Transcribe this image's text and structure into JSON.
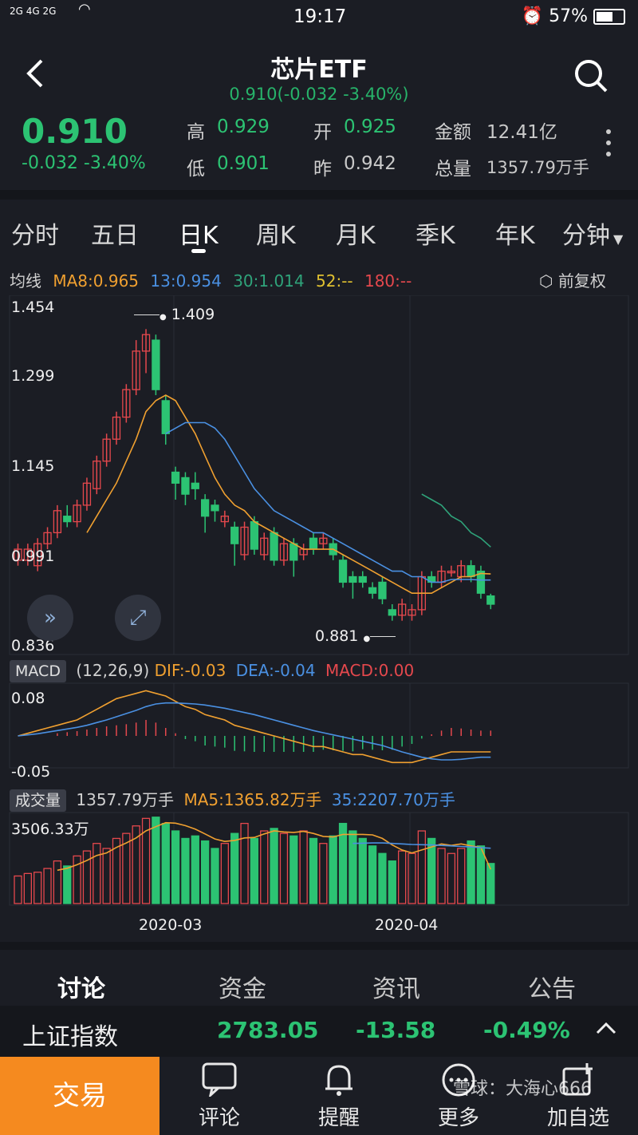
{
  "status": {
    "signal": "2G 4G 2G",
    "time": "19:17",
    "battery": "57%"
  },
  "header": {
    "title": "芯片ETF",
    "subtitle": "0.910(-0.032 -3.40%)"
  },
  "quote": {
    "price": "0.910",
    "change": "-0.032 -3.40%",
    "high_label": "高",
    "high": "0.929",
    "low_label": "低",
    "low": "0.901",
    "open_label": "开",
    "open": "0.925",
    "prev_label": "昨",
    "prev": "0.942",
    "amount_label": "金额",
    "amount": "12.41亿",
    "volume_label": "总量",
    "volume": "1357.79万手"
  },
  "tabs": [
    "分时",
    "五日",
    "日K",
    "周K",
    "月K",
    "季K",
    "年K",
    "分钟"
  ],
  "ma": {
    "label": "均线",
    "ma8": "MA8:0.965",
    "ma13": "13:0.954",
    "ma30": "30:1.014",
    "ma52": "52:--",
    "ma180": "180:--",
    "adjust": "前复权"
  },
  "price_axis": [
    "1.454",
    "1.299",
    "1.145",
    "0.991",
    "0.836"
  ],
  "annotations": {
    "high": "1.409",
    "low": "0.881"
  },
  "macd": {
    "tag": "MACD",
    "params": "(12,26,9)",
    "dif": "DIF:-0.03",
    "dea": "DEA:-0.04",
    "macd": "MACD:0.00",
    "axis_top": "0.08",
    "axis_bottom": "-0.05"
  },
  "vol": {
    "tag": "成交量",
    "total": "1357.79万手",
    "ma5": "MA5:1365.82万手",
    "ma35": "35:2207.70万手",
    "axis_top": "3506.33万"
  },
  "dates": [
    "2020-03",
    "2020-04"
  ],
  "bottom_tabs": [
    "讨论",
    "资金",
    "资讯",
    "公告"
  ],
  "index": {
    "name": "上证指数",
    "value": "2783.05",
    "change": "-13.58",
    "pct": "-0.49%"
  },
  "footer": {
    "trade": "交易",
    "comment": "评论",
    "alert": "提醒",
    "more": "更多",
    "watch": "加自选",
    "watermark": "雪球：大海心666"
  },
  "colors": {
    "up": "#e5484d",
    "down": "#2cc373",
    "ma8": "#f0a030",
    "ma13": "#4a90e2",
    "ma30": "#2fa37a",
    "accent": "#f58a1f"
  },
  "chart_data": {
    "type": "candlestick",
    "candles": [
      {
        "o": 0.99,
        "c": 1.01,
        "h": 1.02,
        "l": 0.98
      },
      {
        "o": 0.99,
        "c": 1.01,
        "h": 1.02,
        "l": 0.98
      },
      {
        "o": 0.98,
        "c": 1.02,
        "h": 1.03,
        "l": 0.97
      },
      {
        "o": 1.02,
        "c": 1.04,
        "h": 1.05,
        "l": 1.01
      },
      {
        "o": 1.04,
        "c": 1.08,
        "h": 1.09,
        "l": 1.03
      },
      {
        "o": 1.07,
        "c": 1.06,
        "h": 1.09,
        "l": 1.05
      },
      {
        "o": 1.06,
        "c": 1.09,
        "h": 1.1,
        "l": 1.05
      },
      {
        "o": 1.09,
        "c": 1.13,
        "h": 1.14,
        "l": 1.08
      },
      {
        "o": 1.12,
        "c": 1.17,
        "h": 1.18,
        "l": 1.11
      },
      {
        "o": 1.17,
        "c": 1.21,
        "h": 1.22,
        "l": 1.16
      },
      {
        "o": 1.21,
        "c": 1.25,
        "h": 1.26,
        "l": 1.2
      },
      {
        "o": 1.25,
        "c": 1.3,
        "h": 1.31,
        "l": 1.24
      },
      {
        "o": 1.3,
        "c": 1.37,
        "h": 1.39,
        "l": 1.29
      },
      {
        "o": 1.37,
        "c": 1.4,
        "h": 1.41,
        "l": 1.33
      },
      {
        "o": 1.39,
        "c": 1.3,
        "h": 1.4,
        "l": 1.29
      },
      {
        "o": 1.28,
        "c": 1.22,
        "h": 1.29,
        "l": 1.2
      },
      {
        "o": 1.15,
        "c": 1.13,
        "h": 1.16,
        "l": 1.1
      },
      {
        "o": 1.14,
        "c": 1.11,
        "h": 1.15,
        "l": 1.09
      },
      {
        "o": 1.13,
        "c": 1.12,
        "h": 1.15,
        "l": 1.1
      },
      {
        "o": 1.1,
        "c": 1.07,
        "h": 1.11,
        "l": 1.04
      },
      {
        "o": 1.09,
        "c": 1.08,
        "h": 1.1,
        "l": 1.06
      },
      {
        "o": 1.06,
        "c": 1.07,
        "h": 1.08,
        "l": 1.05
      },
      {
        "o": 1.05,
        "c": 1.02,
        "h": 1.06,
        "l": 0.98
      },
      {
        "o": 1.0,
        "c": 1.05,
        "h": 1.06,
        "l": 0.99
      },
      {
        "o": 1.06,
        "c": 1.01,
        "h": 1.07,
        "l": 1.0
      },
      {
        "o": 1.0,
        "c": 1.03,
        "h": 1.04,
        "l": 0.99
      },
      {
        "o": 1.04,
        "c": 0.99,
        "h": 1.05,
        "l": 0.98
      },
      {
        "o": 0.99,
        "c": 1.02,
        "h": 1.03,
        "l": 0.98
      },
      {
        "o": 1.02,
        "c": 0.99,
        "h": 1.03,
        "l": 0.96
      },
      {
        "o": 1.0,
        "c": 1.01,
        "h": 1.02,
        "l": 0.99
      },
      {
        "o": 1.03,
        "c": 1.01,
        "h": 1.04,
        "l": 1.0
      },
      {
        "o": 1.02,
        "c": 1.03,
        "h": 1.04,
        "l": 1.01
      },
      {
        "o": 1.02,
        "c": 1.0,
        "h": 1.03,
        "l": 0.99
      },
      {
        "o": 0.99,
        "c": 0.95,
        "h": 1.0,
        "l": 0.94
      },
      {
        "o": 0.96,
        "c": 0.95,
        "h": 0.97,
        "l": 0.92
      },
      {
        "o": 0.96,
        "c": 0.95,
        "h": 0.97,
        "l": 0.94
      },
      {
        "o": 0.94,
        "c": 0.93,
        "h": 0.95,
        "l": 0.92
      },
      {
        "o": 0.95,
        "c": 0.92,
        "h": 0.96,
        "l": 0.91
      },
      {
        "o": 0.9,
        "c": 0.89,
        "h": 0.91,
        "l": 0.88
      },
      {
        "o": 0.89,
        "c": 0.91,
        "h": 0.92,
        "l": 0.88
      },
      {
        "o": 0.89,
        "c": 0.9,
        "h": 0.91,
        "l": 0.88
      },
      {
        "o": 0.9,
        "c": 0.96,
        "h": 0.97,
        "l": 0.89
      },
      {
        "o": 0.96,
        "c": 0.95,
        "h": 0.97,
        "l": 0.94
      },
      {
        "o": 0.95,
        "c": 0.97,
        "h": 0.98,
        "l": 0.94
      },
      {
        "o": 0.97,
        "c": 0.97,
        "h": 0.98,
        "l": 0.96
      },
      {
        "o": 0.96,
        "c": 0.98,
        "h": 0.99,
        "l": 0.95
      },
      {
        "o": 0.98,
        "c": 0.96,
        "h": 0.99,
        "l": 0.95
      },
      {
        "o": 0.97,
        "c": 0.93,
        "h": 0.98,
        "l": 0.92
      },
      {
        "o": 0.925,
        "c": 0.91,
        "h": 0.929,
        "l": 0.901
      }
    ],
    "ma8": [
      null,
      null,
      null,
      null,
      null,
      null,
      null,
      1.04,
      1.07,
      1.1,
      1.13,
      1.17,
      1.21,
      1.26,
      1.28,
      1.29,
      1.28,
      1.25,
      1.22,
      1.18,
      1.14,
      1.11,
      1.09,
      1.08,
      1.06,
      1.05,
      1.04,
      1.03,
      1.02,
      1.01,
      1.01,
      1.01,
      1.01,
      1.0,
      0.99,
      0.98,
      0.97,
      0.96,
      0.95,
      0.94,
      0.93,
      0.93,
      0.93,
      0.94,
      0.95,
      0.96,
      0.96,
      0.966,
      0.965
    ],
    "ma13": [
      null,
      null,
      null,
      null,
      null,
      null,
      null,
      null,
      null,
      null,
      null,
      null,
      null,
      null,
      null,
      1.22,
      1.23,
      1.24,
      1.24,
      1.24,
      1.23,
      1.21,
      1.18,
      1.15,
      1.12,
      1.1,
      1.08,
      1.07,
      1.06,
      1.05,
      1.04,
      1.04,
      1.03,
      1.02,
      1.01,
      1.0,
      0.99,
      0.98,
      0.97,
      0.97,
      0.96,
      0.96,
      0.95,
      0.95,
      0.955,
      0.955,
      0.955,
      0.954,
      0.954
    ],
    "ma30": [
      null,
      null,
      null,
      null,
      null,
      null,
      null,
      null,
      null,
      null,
      null,
      null,
      null,
      null,
      null,
      null,
      null,
      null,
      null,
      null,
      null,
      null,
      null,
      null,
      null,
      null,
      null,
      null,
      null,
      null,
      null,
      null,
      null,
      null,
      null,
      null,
      null,
      null,
      null,
      null,
      null,
      1.11,
      1.1,
      1.09,
      1.07,
      1.06,
      1.04,
      1.03,
      1.014
    ],
    "macd_dif": [
      0.0,
      0.005,
      0.01,
      0.015,
      0.02,
      0.025,
      0.03,
      0.04,
      0.05,
      0.06,
      0.07,
      0.075,
      0.08,
      0.085,
      0.08,
      0.075,
      0.065,
      0.055,
      0.05,
      0.04,
      0.035,
      0.03,
      0.02,
      0.015,
      0.01,
      0.005,
      0.0,
      -0.005,
      -0.01,
      -0.015,
      -0.02,
      -0.02,
      -0.025,
      -0.03,
      -0.035,
      -0.035,
      -0.04,
      -0.045,
      -0.05,
      -0.05,
      -0.05,
      -0.045,
      -0.04,
      -0.035,
      -0.03,
      -0.03,
      -0.03,
      -0.03,
      -0.03
    ],
    "macd_dea": [
      0.0,
      0.002,
      0.004,
      0.007,
      0.01,
      0.013,
      0.016,
      0.02,
      0.025,
      0.03,
      0.036,
      0.042,
      0.048,
      0.055,
      0.06,
      0.062,
      0.062,
      0.061,
      0.06,
      0.058,
      0.055,
      0.052,
      0.048,
      0.044,
      0.04,
      0.035,
      0.03,
      0.025,
      0.02,
      0.015,
      0.01,
      0.006,
      0.002,
      -0.002,
      -0.006,
      -0.01,
      -0.014,
      -0.018,
      -0.024,
      -0.03,
      -0.035,
      -0.04,
      -0.043,
      -0.045,
      -0.045,
      -0.044,
      -0.042,
      -0.04,
      -0.04
    ],
    "macd_hist": [
      0,
      0,
      0,
      0,
      0.005,
      0.007,
      0.009,
      0.012,
      0.015,
      0.018,
      0.02,
      0.022,
      0.025,
      0.03,
      0.025,
      0.015,
      0.005,
      -0.006,
      -0.01,
      -0.018,
      -0.02,
      -0.022,
      -0.028,
      -0.029,
      -0.03,
      -0.03,
      -0.03,
      -0.03,
      -0.03,
      -0.03,
      -0.03,
      -0.026,
      -0.027,
      -0.028,
      -0.029,
      -0.025,
      -0.026,
      -0.027,
      -0.026,
      -0.02,
      -0.015,
      -0.005,
      0.003,
      0.01,
      0.015,
      0.014,
      0.012,
      0.01,
      0.01
    ],
    "volumes": [
      1100,
      1200,
      1250,
      1400,
      1700,
      1500,
      1900,
      2100,
      2400,
      2200,
      2600,
      2800,
      3100,
      3400,
      3450,
      3200,
      2900,
      2600,
      2700,
      2500,
      2200,
      2400,
      2800,
      3200,
      2600,
      2900,
      3000,
      2800,
      2700,
      2900,
      2600,
      2400,
      2700,
      3200,
      2900,
      2600,
      2300,
      2000,
      1700,
      2100,
      2000,
      2900,
      2600,
      2200,
      2000,
      2200,
      2500,
      2300,
      1600
    ],
    "vol_ma5": [
      null,
      null,
      null,
      null,
      1330,
      1410,
      1550,
      1720,
      1920,
      2020,
      2240,
      2420,
      2620,
      2900,
      3070,
      3230,
      3210,
      3110,
      2970,
      2780,
      2580,
      2480,
      2520,
      2620,
      2640,
      2780,
      2900,
      2860,
      2840,
      2880,
      2800,
      2680,
      2660,
      2760,
      2760,
      2760,
      2740,
      2600,
      2340,
      2140,
      2020,
      2140,
      2260,
      2380,
      2320,
      2380,
      2300,
      2240,
      1365.82
    ],
    "vol_ma35": [
      null,
      null,
      null,
      null,
      null,
      null,
      null,
      null,
      null,
      null,
      null,
      null,
      null,
      null,
      null,
      null,
      null,
      null,
      null,
      null,
      null,
      null,
      null,
      null,
      null,
      null,
      null,
      null,
      null,
      null,
      null,
      null,
      null,
      null,
      2400,
      2410,
      2420,
      2420,
      2400,
      2380,
      2360,
      2350,
      2340,
      2320,
      2300,
      2280,
      2260,
      2230,
      2207.7
    ],
    "y_range": [
      0.836,
      1.454
    ],
    "vol_max": 3506.33,
    "macd_range": [
      -0.06,
      0.09
    ]
  }
}
